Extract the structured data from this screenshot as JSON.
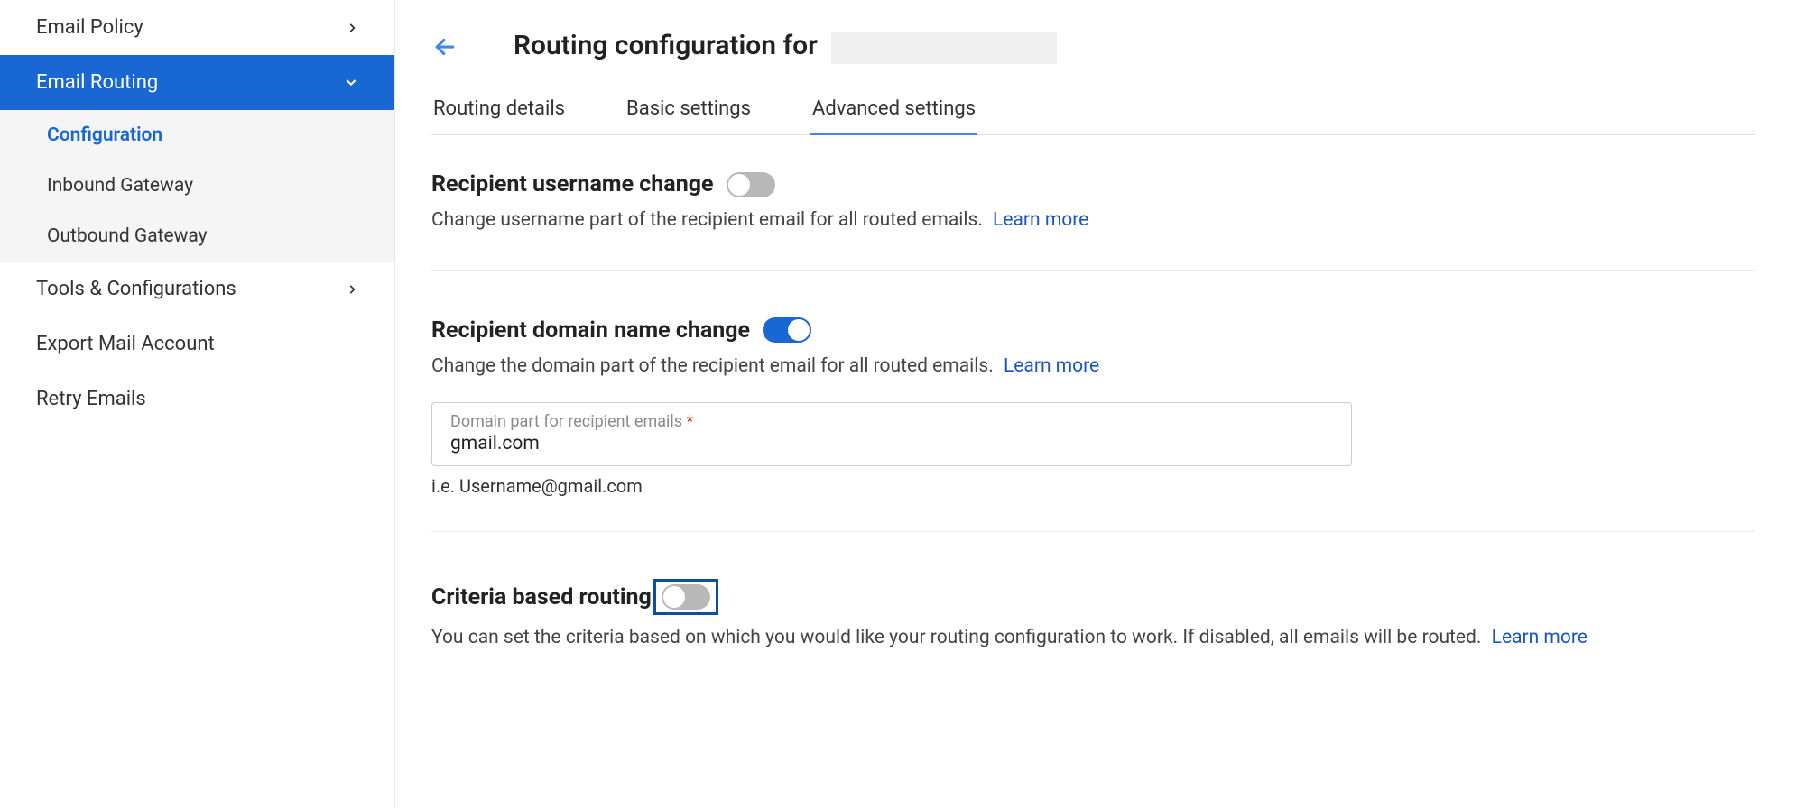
{
  "sidebar": {
    "items": [
      {
        "label": "Email Policy",
        "expandable": true,
        "expanded": false
      },
      {
        "label": "Email Routing",
        "expandable": true,
        "expanded": true,
        "active": true,
        "children": [
          {
            "label": "Configuration",
            "selected": true
          },
          {
            "label": "Inbound Gateway",
            "selected": false
          },
          {
            "label": "Outbound Gateway",
            "selected": false
          }
        ]
      },
      {
        "label": "Tools & Configurations",
        "expandable": true,
        "expanded": false
      },
      {
        "label": "Export Mail Account",
        "expandable": false
      },
      {
        "label": "Retry Emails",
        "expandable": false
      }
    ]
  },
  "header": {
    "title": "Routing configuration for"
  },
  "tabs": [
    {
      "label": "Routing details",
      "active": false
    },
    {
      "label": "Basic settings",
      "active": false
    },
    {
      "label": "Advanced settings",
      "active": true
    }
  ],
  "sections": {
    "username": {
      "title": "Recipient username change",
      "enabled": false,
      "desc": "Change username part of the recipient email for all routed emails.",
      "learn_more": "Learn more"
    },
    "domain": {
      "title": "Recipient domain name change",
      "enabled": true,
      "desc": "Change the domain part of the recipient email for all routed emails.",
      "learn_more": "Learn more",
      "field_label": "Domain part for recipient emails",
      "field_value": "gmail.com",
      "hint": "i.e. Username@gmail.com"
    },
    "criteria": {
      "title": "Criteria based routing",
      "enabled": false,
      "highlighted": true,
      "desc": "You can set the criteria based on which you would like your routing configuration to work. If disabled, all emails will be routed.",
      "learn_more": "Learn more"
    }
  }
}
